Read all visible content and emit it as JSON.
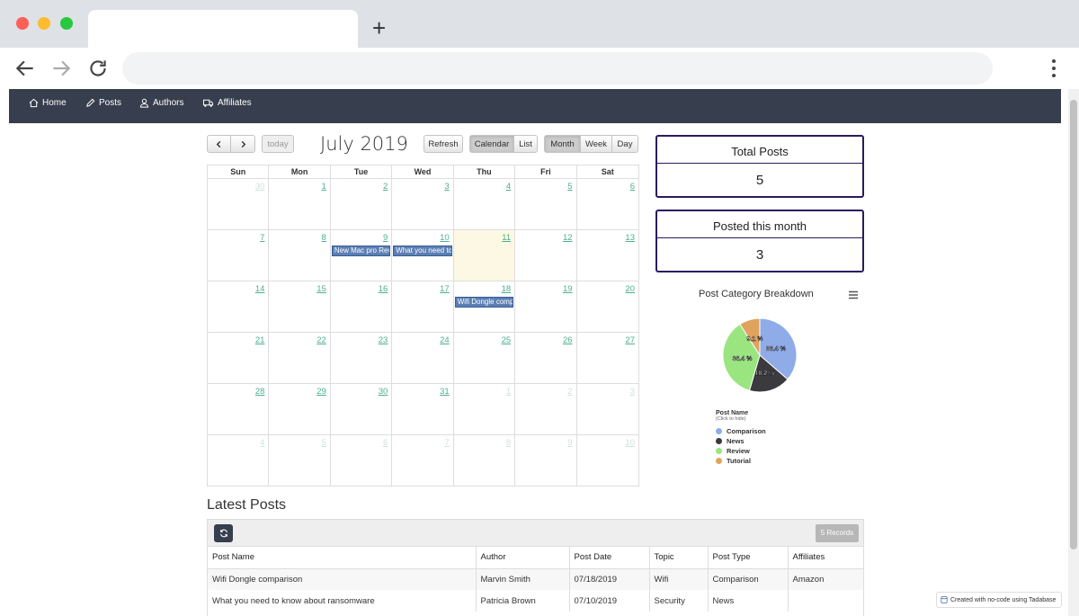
{
  "nav": {
    "home": "Home",
    "posts": "Posts",
    "authors": "Authors",
    "affiliates": "Affiliates"
  },
  "calendar": {
    "title": "July 2019",
    "today_label": "today",
    "refresh_label": "Refresh",
    "calendar_label": "Calendar",
    "list_label": "List",
    "month_label": "Month",
    "week_label": "Week",
    "day_label": "Day",
    "weekdays": [
      "Sun",
      "Mon",
      "Tue",
      "Wed",
      "Thu",
      "Fri",
      "Sat"
    ],
    "weeks": [
      [
        {
          "d": "30",
          "other": true
        },
        {
          "d": "1"
        },
        {
          "d": "2"
        },
        {
          "d": "3"
        },
        {
          "d": "4"
        },
        {
          "d": "5"
        },
        {
          "d": "6"
        }
      ],
      [
        {
          "d": "7"
        },
        {
          "d": "8"
        },
        {
          "d": "9",
          "event": "New Mac pro Revi"
        },
        {
          "d": "10",
          "event": "What you need to"
        },
        {
          "d": "11",
          "today": true
        },
        {
          "d": "12"
        },
        {
          "d": "13"
        }
      ],
      [
        {
          "d": "14"
        },
        {
          "d": "15"
        },
        {
          "d": "16"
        },
        {
          "d": "17"
        },
        {
          "d": "18",
          "event": "Wifi Dongle comp"
        },
        {
          "d": "19"
        },
        {
          "d": "20"
        }
      ],
      [
        {
          "d": "21"
        },
        {
          "d": "22"
        },
        {
          "d": "23"
        },
        {
          "d": "24"
        },
        {
          "d": "25"
        },
        {
          "d": "26"
        },
        {
          "d": "27"
        }
      ],
      [
        {
          "d": "28"
        },
        {
          "d": "29"
        },
        {
          "d": "30"
        },
        {
          "d": "31"
        },
        {
          "d": "1",
          "other": true
        },
        {
          "d": "2",
          "other": true
        },
        {
          "d": "3",
          "other": true
        }
      ],
      [
        {
          "d": "4",
          "other": true
        },
        {
          "d": "5",
          "other": true
        },
        {
          "d": "6",
          "other": true
        },
        {
          "d": "7",
          "other": true
        },
        {
          "d": "8",
          "other": true
        },
        {
          "d": "9",
          "other": true
        },
        {
          "d": "10",
          "other": true
        }
      ]
    ]
  },
  "stats": {
    "total_title": "Total Posts",
    "total_value": "5",
    "month_title": "Posted this month",
    "month_value": "3"
  },
  "chart_data": {
    "type": "pie",
    "title": "Post Category Breakdown",
    "legend_title": "Post Name",
    "legend_subtitle": "(Click to hide)",
    "categories": [
      "Comparison",
      "News",
      "Review",
      "Tutorial"
    ],
    "values": [
      36.4,
      18.2,
      36.4,
      9.1
    ],
    "labels": [
      "36.4 %",
      "18.2 %",
      "36.4 %",
      "9.1 %"
    ],
    "colors": [
      "#8fabe8",
      "#3a3a3f",
      "#9ae57f",
      "#e0a35e"
    ]
  },
  "latest_posts": {
    "title": "Latest Posts",
    "records_label": "5 Records",
    "columns": [
      "Post Name",
      "Author",
      "Post Date",
      "Topic",
      "Post Type",
      "Affiliates"
    ],
    "rows": [
      [
        "Wifi Dongle comparison",
        "Marvin Smith",
        "07/18/2019",
        "Wifi",
        "Comparison",
        "Amazon"
      ],
      [
        "What you need to know about ransomware",
        "Patricia Brown",
        "07/10/2019",
        "Security",
        "News",
        ""
      ]
    ]
  },
  "badge_text": "Created with no-code using Tadabase"
}
